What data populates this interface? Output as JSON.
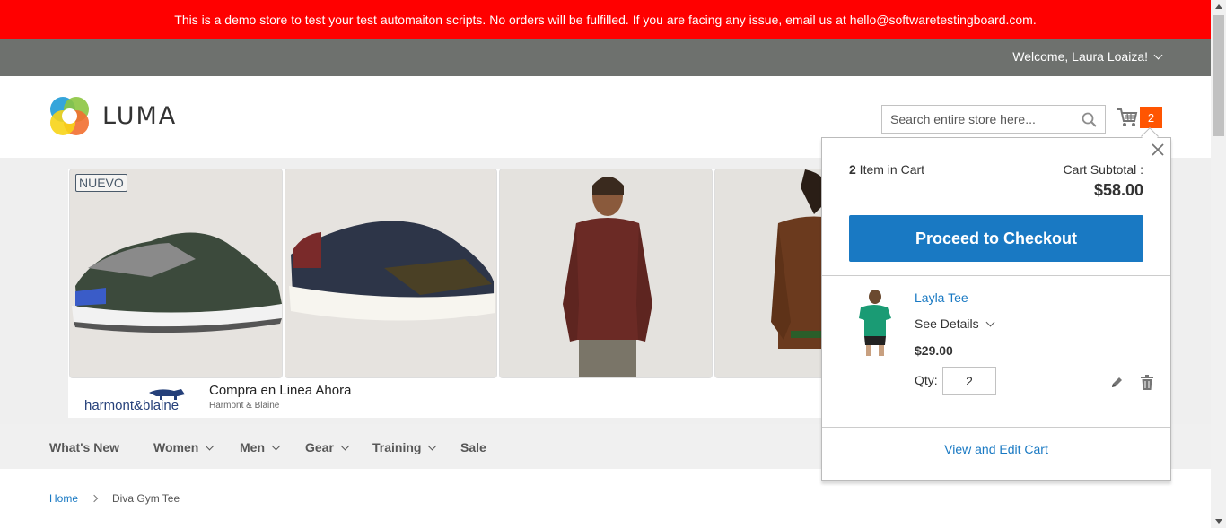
{
  "banner": {
    "text": "This is a demo store to test your test automaiton scripts. No orders will be fulfilled. If you are facing any issue, email us at hello@softwaretestingboard.com."
  },
  "header": {
    "welcome": "Welcome, Laura Loaiza!",
    "logo_text": "LUMA",
    "search_placeholder": "Search entire store here...",
    "cart_count": "2"
  },
  "ad": {
    "badge": "NUEVO",
    "brand": "harmont&blaine",
    "title": "Compra en Linea Ahora",
    "subtitle": "Harmont & Blaine"
  },
  "nav": {
    "items": [
      {
        "label": "What's New"
      },
      {
        "label": "Women"
      },
      {
        "label": "Men"
      },
      {
        "label": "Gear"
      },
      {
        "label": "Training"
      },
      {
        "label": "Sale"
      }
    ]
  },
  "breadcrumb": {
    "home": "Home",
    "current": "Diva Gym Tee"
  },
  "minicart": {
    "count_number": "2",
    "count_text": " Item in Cart",
    "subtotal_label": "Cart Subtotal :",
    "subtotal_value": "$58.00",
    "checkout_label": "Proceed to Checkout",
    "item": {
      "name": "Layla Tee",
      "see_details": "See Details",
      "price": "$29.00",
      "qty_label": "Qty:",
      "qty_value": "2"
    },
    "view_cart": "View and Edit Cart"
  },
  "colors": {
    "banner_bg": "#ff0000",
    "topbar_bg": "#6e716e",
    "link": "#1979c3",
    "cart_badge": "#ff5501",
    "nav_bg": "#f0f0f0"
  }
}
